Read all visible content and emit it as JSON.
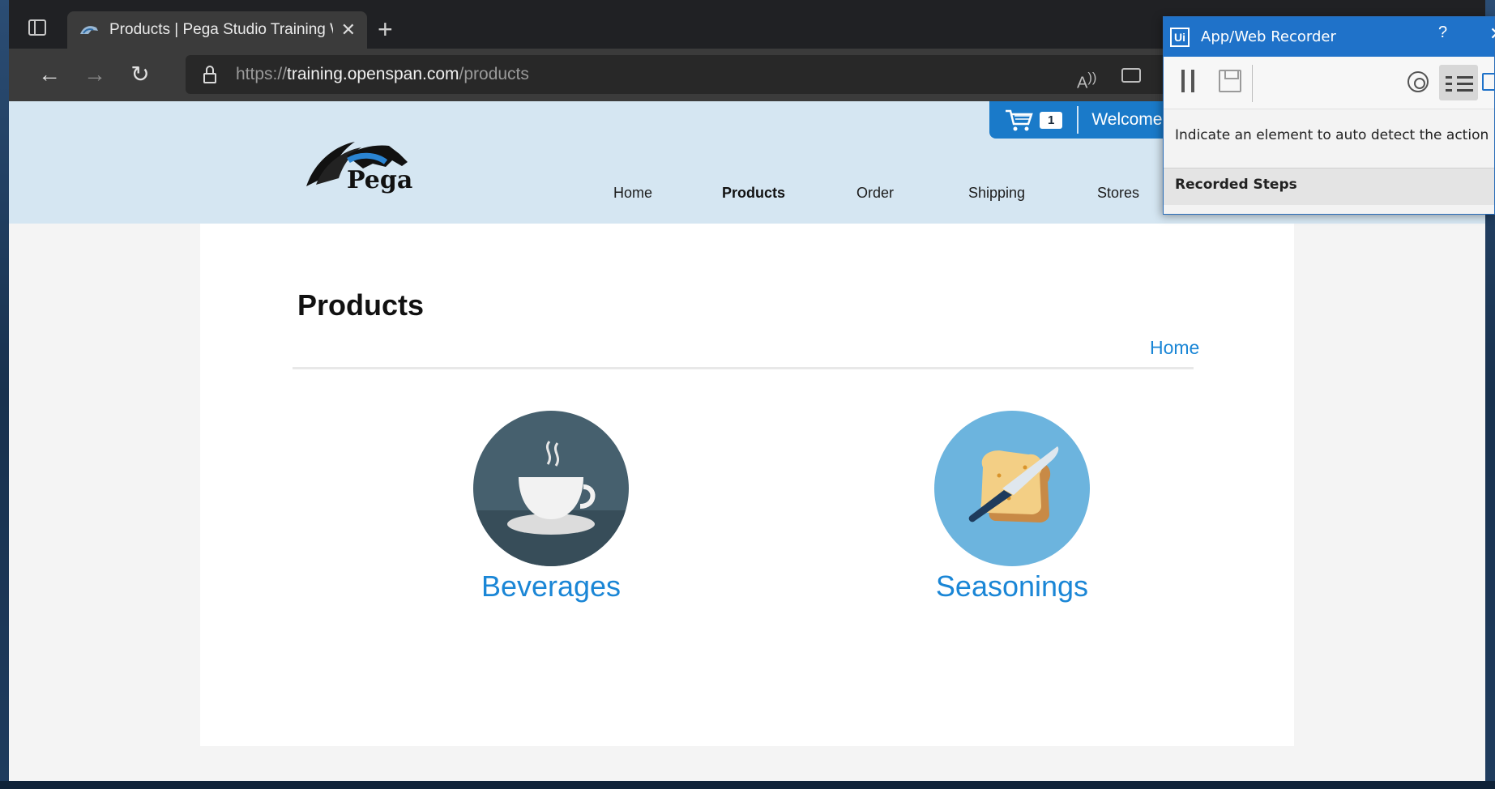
{
  "browser": {
    "tab_title": "Products | Pega Studio Training W",
    "url_scheme": "https://",
    "url_host": "training.openspan.com",
    "url_path": "/products",
    "new_tab_label": "+",
    "close_tab_label": "✕"
  },
  "site": {
    "logo_text": "Pega",
    "cart_count": "1",
    "welcome_text": "Welcome",
    "nav": [
      {
        "label": "Home"
      },
      {
        "label": "Products"
      },
      {
        "label": "Order"
      },
      {
        "label": "Shipping"
      },
      {
        "label": "Stores"
      }
    ]
  },
  "main": {
    "title": "Products",
    "breadcrumb": "Home",
    "categories": [
      {
        "label": "Beverages",
        "icon": "coffee-cup-icon"
      },
      {
        "label": "Seasonings",
        "icon": "bread-knife-icon"
      }
    ]
  },
  "recorder": {
    "logo": "Ui",
    "title": "App/Web Recorder",
    "help": "?",
    "close": "✕",
    "hint": "Indicate an element to auto detect the action",
    "steps_header": "Recorded Steps"
  },
  "colors": {
    "accent": "#1a86d6",
    "header_bg": "#d5e6f2",
    "cart_bg": "#1a7ac9",
    "recorder_title": "#1f72c9"
  }
}
